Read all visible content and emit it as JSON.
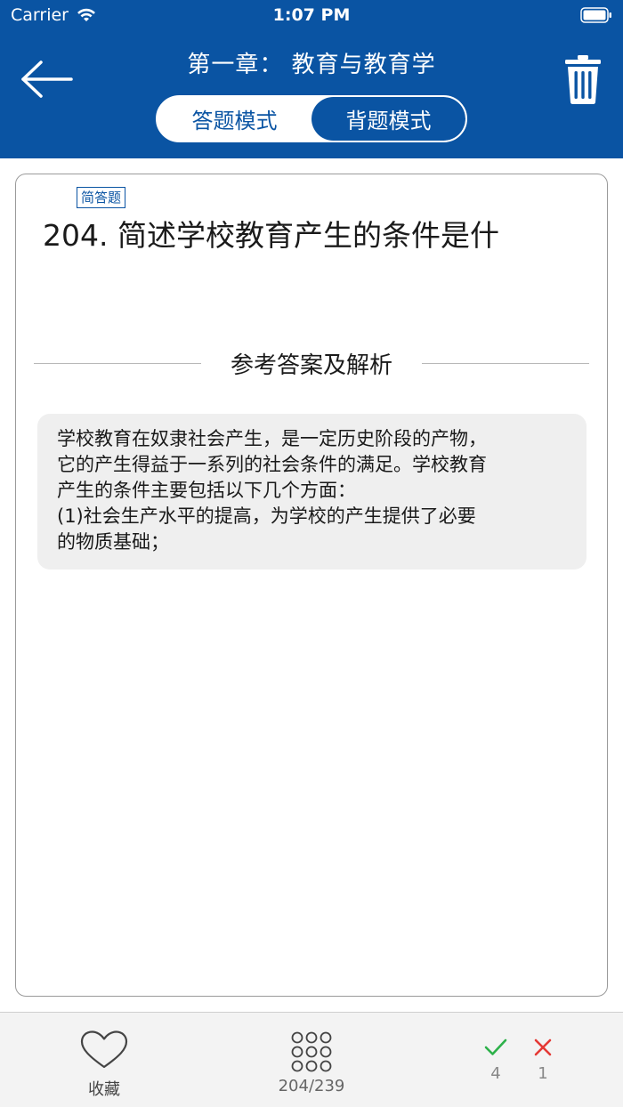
{
  "status_bar": {
    "carrier": "Carrier",
    "time": "1:07 PM"
  },
  "header": {
    "title": "第一章： 教育与教育学",
    "mode_answer": "答题模式",
    "mode_review": "背题模式",
    "active_mode": "背题模式",
    "back_icon": "arrow-left-icon",
    "trash_icon": "trash-icon"
  },
  "question": {
    "type_badge": "简答题",
    "text": "204. 简述学校教育产生的条件是什"
  },
  "answer": {
    "section_label": "参考答案及解析",
    "lines": [
      "学校教育在奴隶社会产生，是一定历史阶段的产物，",
      "它的产生得益于一系列的社会条件的满足。学校教育",
      "产生的条件主要包括以下几个方面：",
      "(1)社会生产水平的提高，为学校的产生提供了必要",
      "的物质基础；"
    ]
  },
  "bottom_bar": {
    "favorite_label": "收藏",
    "progress": "204/239",
    "correct_count": "4",
    "wrong_count": "1",
    "colors": {
      "correct": "#2db14a",
      "wrong": "#e53935"
    }
  },
  "colors": {
    "brand": "#0a54a3"
  }
}
